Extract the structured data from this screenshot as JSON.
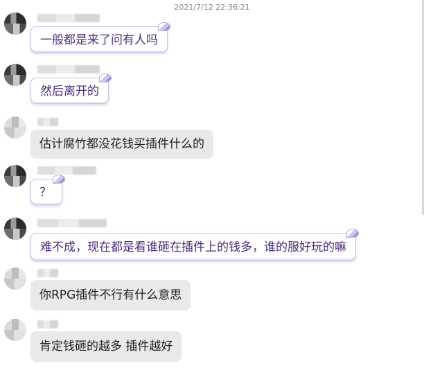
{
  "chat": {
    "timestamp": "2021/7/12 22:36:21",
    "messages": [
      {
        "text": "一般都是来了问有人吗",
        "style": "styled",
        "avatar": "dark"
      },
      {
        "text": "然后离开的",
        "style": "styled",
        "avatar": "dark"
      },
      {
        "text": "估计腐竹都没花钱买插件什么的",
        "style": "plain",
        "avatar": "light"
      },
      {
        "text": "？",
        "style": "styled",
        "avatar": "dark"
      },
      {
        "text": "难不成，现在都是看谁砸在插件上的钱多，谁的服好玩的嘛",
        "style": "styled",
        "avatar": "dark"
      },
      {
        "text": "你RPG插件不行有什么意思",
        "style": "plain",
        "avatar": "light"
      },
      {
        "text": "肯定钱砸的越多 插件越好",
        "style": "plain",
        "avatar": "light"
      }
    ]
  }
}
